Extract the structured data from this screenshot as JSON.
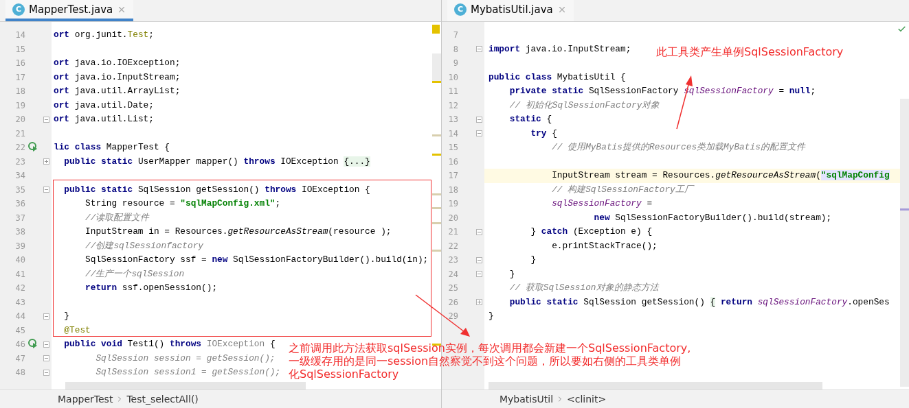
{
  "panes": [
    {
      "tab": {
        "icon_text": "C",
        "label": "MapperTest.java",
        "selected": true
      },
      "lines": [
        {
          "number": "14",
          "segments": [
            {
              "text": "ort",
              "kind": "keyword"
            },
            {
              "text": " org.junit.",
              "kind": "plain"
            },
            {
              "text": "Test",
              "kind": "annotation"
            },
            {
              "text": ";",
              "kind": "plain"
            }
          ]
        },
        {
          "number": "15"
        },
        {
          "number": "16",
          "segments": [
            {
              "text": "ort",
              "kind": "keyword"
            },
            {
              "text": " java.io.IOException;",
              "kind": "plain"
            }
          ]
        },
        {
          "number": "17",
          "segments": [
            {
              "text": "ort",
              "kind": "keyword"
            },
            {
              "text": " java.io.InputStream;",
              "kind": "plain"
            }
          ]
        },
        {
          "number": "18",
          "segments": [
            {
              "text": "ort",
              "kind": "keyword"
            },
            {
              "text": " java.util.ArrayList;",
              "kind": "plain"
            }
          ]
        },
        {
          "number": "19",
          "segments": [
            {
              "text": "ort",
              "kind": "keyword"
            },
            {
              "text": " java.util.Date;",
              "kind": "plain"
            }
          ]
        },
        {
          "number": "20",
          "collapsed": false,
          "segments": [
            {
              "text": "ort",
              "kind": "keyword"
            },
            {
              "text": " java.util.List;",
              "kind": "plain"
            }
          ]
        },
        {
          "number": "21"
        },
        {
          "number": "22",
          "run": true,
          "segments": [
            {
              "text": "lic class",
              "kind": "keyword"
            },
            {
              "text": " MapperTest {",
              "kind": "plain"
            }
          ]
        },
        {
          "number": "23",
          "collapsed": true,
          "segments": [
            {
              "text": "  public static",
              "kind": "keyword"
            },
            {
              "text": " UserMapper mapper() ",
              "kind": "plain"
            },
            {
              "text": "throws",
              "kind": "keyword"
            },
            {
              "text": " IOException ",
              "kind": "plain"
            },
            {
              "text": "{...}",
              "kind": "folded"
            }
          ]
        },
        {
          "number": "34"
        },
        {
          "number": "35",
          "collapsed": false,
          "segments": [
            {
              "text": "  public static",
              "kind": "keyword"
            },
            {
              "text": " SqlSession getSession() ",
              "kind": "plain"
            },
            {
              "text": "throws",
              "kind": "keyword"
            },
            {
              "text": " IOException {",
              "kind": "plain"
            }
          ]
        },
        {
          "number": "36",
          "segments": [
            {
              "text": "      String resource = ",
              "kind": "plain"
            },
            {
              "text": "\"sqlMapConfig.xml\"",
              "kind": "string"
            },
            {
              "text": ";",
              "kind": "plain"
            }
          ]
        },
        {
          "number": "37",
          "segments": [
            {
              "text": "      //读取配置文件",
              "kind": "comment"
            }
          ]
        },
        {
          "number": "38",
          "segments": [
            {
              "text": "      InputStream in = Resources.",
              "kind": "plain"
            },
            {
              "text": "getResourceAsStream",
              "kind": "static"
            },
            {
              "text": "(resource );",
              "kind": "plain"
            }
          ]
        },
        {
          "number": "39",
          "segments": [
            {
              "text": "      //创建sqlSessionfactory",
              "kind": "comment"
            }
          ]
        },
        {
          "number": "40",
          "segments": [
            {
              "text": "      SqlSessionFactory ssf = ",
              "kind": "plain"
            },
            {
              "text": "new",
              "kind": "keyword"
            },
            {
              "text": " SqlSessionFactoryBuilder().build(in);",
              "kind": "plain"
            }
          ]
        },
        {
          "number": "41",
          "segments": [
            {
              "text": "      //生产一个sqlSession",
              "kind": "comment"
            }
          ]
        },
        {
          "number": "42",
          "segments": [
            {
              "text": "      return",
              "kind": "keyword"
            },
            {
              "text": " ssf.openSession();",
              "kind": "plain"
            }
          ]
        },
        {
          "number": "43"
        },
        {
          "number": "44",
          "collapsed": false,
          "segments": [
            {
              "text": "  }",
              "kind": "plain"
            }
          ]
        },
        {
          "number": "45",
          "segments": [
            {
              "text": "  @Test",
              "kind": "annotation"
            }
          ]
        },
        {
          "number": "46",
          "run": true,
          "collapsed": false,
          "segments": [
            {
              "text": "  public void",
              "kind": "keyword"
            },
            {
              "text": " Test1() ",
              "kind": "plain"
            },
            {
              "text": "throws ",
              "kind": "keyword"
            },
            {
              "text": "IOException",
              "kind": "unused-type"
            },
            {
              "text": " {",
              "kind": "plain"
            }
          ]
        },
        {
          "number": "47",
          "collapsed": false,
          "segments": [
            {
              "text": "        SqlSession session = getSession();",
              "kind": "unused"
            }
          ]
        },
        {
          "number": "48",
          "collapsed": false,
          "segments": [
            {
              "text": "        SqlSession session1 = getSession();",
              "kind": "unused"
            }
          ]
        }
      ],
      "breadcrumbs": [
        "MapperTest",
        "Test_selectAll()"
      ]
    },
    {
      "tab": {
        "icon_text": "C",
        "label": "MybatisUtil.java",
        "selected": false
      },
      "lines": [
        {
          "number": "7"
        },
        {
          "number": "8",
          "collapsed": false,
          "segments": [
            {
              "text": "import",
              "kind": "keyword"
            },
            {
              "text": " java.io.InputStream;",
              "kind": "plain"
            }
          ]
        },
        {
          "number": "9"
        },
        {
          "number": "10",
          "segments": [
            {
              "text": "public class",
              "kind": "keyword"
            },
            {
              "text": " MybatisUtil {",
              "kind": "plain"
            }
          ]
        },
        {
          "number": "11",
          "segments": [
            {
              "text": "    private static",
              "kind": "keyword"
            },
            {
              "text": " SqlSessionFactory ",
              "kind": "plain"
            },
            {
              "text": "sqlSessionFactory",
              "kind": "field"
            },
            {
              "text": " = ",
              "kind": "plain"
            },
            {
              "text": "null",
              "kind": "keyword"
            },
            {
              "text": ";",
              "kind": "plain"
            }
          ]
        },
        {
          "number": "12",
          "segments": [
            {
              "text": "    // 初始化SqlSessionFactory对象",
              "kind": "comment"
            }
          ]
        },
        {
          "number": "13",
          "collapsed": false,
          "segments": [
            {
              "text": "    static",
              "kind": "keyword"
            },
            {
              "text": " {",
              "kind": "plain"
            }
          ]
        },
        {
          "number": "14",
          "collapsed": false,
          "segments": [
            {
              "text": "        try",
              "kind": "keyword"
            },
            {
              "text": " {",
              "kind": "plain"
            }
          ]
        },
        {
          "number": "15",
          "segments": [
            {
              "text": "            // 使用MyBatis提供的Resources类加载MyBatis的配置文件",
              "kind": "comment"
            }
          ]
        },
        {
          "number": "16"
        },
        {
          "number": "17",
          "current": true,
          "segments": [
            {
              "text": "            InputStream stream = Resources.",
              "kind": "plain"
            },
            {
              "text": "getResourceAsStream",
              "kind": "static"
            },
            {
              "text": "(",
              "kind": "plain"
            },
            {
              "text": "\"sqlMapConfig",
              "kind": "match"
            }
          ]
        },
        {
          "number": "18",
          "segments": [
            {
              "text": "            // 构建SqlSessionFactory工厂",
              "kind": "comment"
            }
          ]
        },
        {
          "number": "19",
          "segments": [
            {
              "text": "            sqlSessionFactory",
              "kind": "field"
            },
            {
              "text": " =",
              "kind": "plain"
            }
          ]
        },
        {
          "number": "20",
          "segments": [
            {
              "text": "                    new",
              "kind": "keyword"
            },
            {
              "text": " SqlSessionFactoryBuilder().build(stream);",
              "kind": "plain"
            }
          ]
        },
        {
          "number": "21",
          "collapsed": false,
          "segments": [
            {
              "text": "        } ",
              "kind": "plain"
            },
            {
              "text": "catch",
              "kind": "keyword"
            },
            {
              "text": " (Exception e) {",
              "kind": "plain"
            }
          ]
        },
        {
          "number": "22",
          "segments": [
            {
              "text": "            e.printStackTrace();",
              "kind": "plain"
            }
          ]
        },
        {
          "number": "23",
          "collapsed": false,
          "segments": [
            {
              "text": "        }",
              "kind": "plain"
            }
          ]
        },
        {
          "number": "24",
          "collapsed": false,
          "segments": [
            {
              "text": "    }",
              "kind": "plain"
            }
          ]
        },
        {
          "number": "25",
          "segments": [
            {
              "text": "    // 获取SqlSession对象的静态方法",
              "kind": "comment"
            }
          ]
        },
        {
          "number": "26",
          "collapsed": true,
          "segments": [
            {
              "text": "    public static",
              "kind": "keyword"
            },
            {
              "text": " SqlSession getSession() ",
              "kind": "plain"
            },
            {
              "text": "{",
              "kind": "folded"
            },
            {
              "text": " return",
              "kind": "keyword"
            },
            {
              "text": " sqlSessionFactory",
              "kind": "field"
            },
            {
              "text": ".openSes",
              "kind": "plain"
            }
          ]
        },
        {
          "number": "29",
          "segments": [
            {
              "text": "}",
              "kind": "plain"
            }
          ]
        }
      ],
      "breadcrumbs": [
        "MybatisUtil",
        "<clinit>"
      ]
    }
  ],
  "annotations": {
    "top_note": "此工具类产生单例SqlSessionFactory",
    "bottom_note": [
      "之前调用此方法获取sqlSession实例，每次调用都会新建一个SqlSessionFactory,",
      "一级缓存用的是同一session自然察觉不到这个问题，所以要如右侧的工具类单例",
      "化SqlSessionFactory"
    ]
  }
}
